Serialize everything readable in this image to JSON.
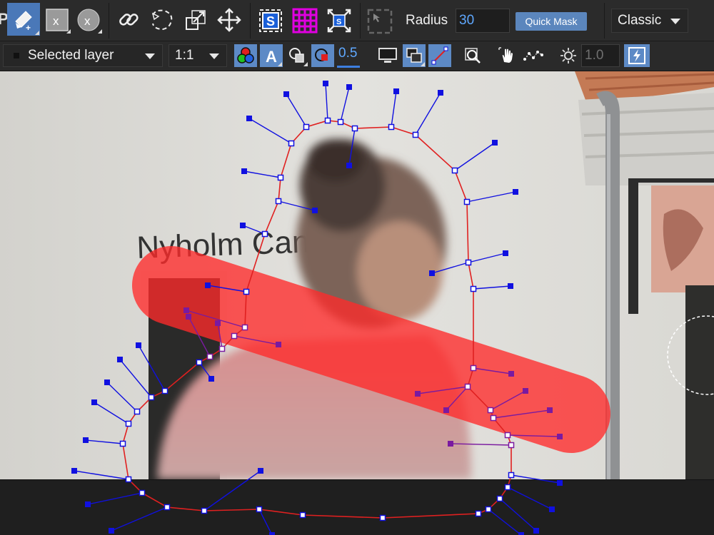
{
  "toolbar_top": {
    "radius_label": "Radius",
    "radius_value": "30",
    "quick_mask_label": "Quick Mask",
    "mode_selected": "Classic"
  },
  "toolbar_second": {
    "layer_selected": "Selected layer",
    "zoom_selected": "1:1",
    "opacity_value": "0.5",
    "brightness_value": "1.0"
  },
  "photo": {
    "sign_text": "Nyholm Cantr"
  },
  "colors": {
    "toolbar_bg": "#2b2b2b",
    "accent_blue": "#4a78b8",
    "field_value": "#5fa8ff",
    "path_red": "#e02020",
    "handle_blue": "#1010e0",
    "handle_purple": "#7a1aa0",
    "mask_red": "#ff2a2a"
  },
  "icons": [
    "brush-add-icon",
    "eraser-square-icon",
    "eraser-circle-icon",
    "link-icon",
    "lasso-icon",
    "scale-icon",
    "move-icon",
    "smart-select-icon",
    "grid-icon",
    "fit-icon",
    "rect-select-icon",
    "channels-icon",
    "text-icon",
    "overlay-icon",
    "mask-icon",
    "monitor-icon",
    "layers-icon",
    "line-icon",
    "zoom-icon",
    "hand-icon",
    "path-icon",
    "brightness-icon",
    "flash-icon"
  ]
}
